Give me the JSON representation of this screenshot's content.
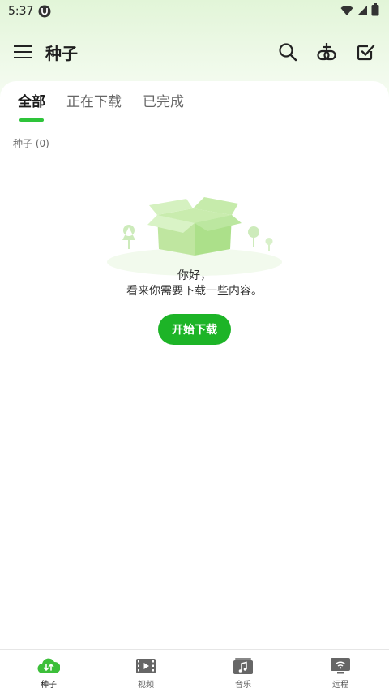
{
  "status_bar": {
    "time": "5:37"
  },
  "app_bar": {
    "title": "种子"
  },
  "tabs": [
    {
      "label": "全部",
      "active": true
    },
    {
      "label": "正在下载",
      "active": false
    },
    {
      "label": "已完成",
      "active": false
    }
  ],
  "section": {
    "count_label": "种子 (0)"
  },
  "empty_state": {
    "line1": "你好，",
    "line2": "看来你需要下载一些内容。",
    "button_label": "开始下载"
  },
  "bottom_nav": [
    {
      "label": "种子",
      "icon": "torrent-icon",
      "active": true
    },
    {
      "label": "视频",
      "icon": "video-icon",
      "active": false
    },
    {
      "label": "音乐",
      "icon": "music-icon",
      "active": false
    },
    {
      "label": "远程",
      "icon": "remote-icon",
      "active": false
    }
  ],
  "colors": {
    "accent": "#1db427",
    "tab_indicator": "#2ec43a",
    "header_bg": "#e2f5d8"
  }
}
